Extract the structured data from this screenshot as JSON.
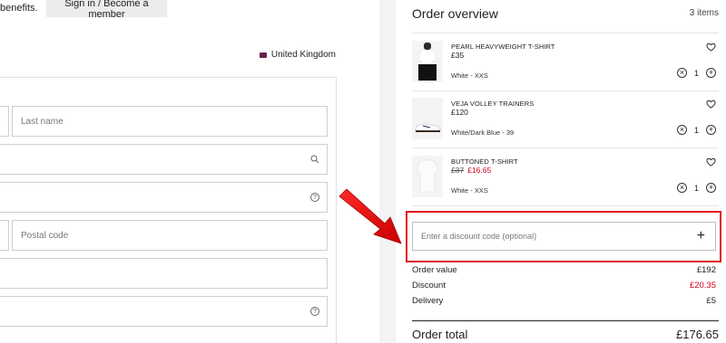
{
  "header": {
    "benefits_text": "benefits.",
    "signin_label": "Sign in / Become a member"
  },
  "country": {
    "label": "United Kingdom",
    "flag_color": "#6f1f4b"
  },
  "form": {
    "last_name_placeholder": "Last name",
    "postal_code_placeholder": "Postal code",
    "help_glyph": "?"
  },
  "overview": {
    "title": "Order overview",
    "count": "3 items",
    "items": [
      {
        "name": "PEARL HEAVYWEIGHT T-SHIRT",
        "price": "£35",
        "variant": "White - XXS",
        "qty": "1"
      },
      {
        "name": "VEJA VOLLEY TRAINERS",
        "price": "£120",
        "variant": "White/Dark Blue - 39",
        "qty": "1"
      },
      {
        "name": "BUTTONED T-SHIRT",
        "old_price": "£37",
        "new_price": "£16.65",
        "variant": "White - XXS",
        "qty": "1"
      }
    ],
    "discount_placeholder": "Enter a discount code (optional)",
    "summary": {
      "order_value_label": "Order value",
      "order_value": "£192",
      "discount_label": "Discount",
      "discount": "£20.35",
      "delivery_label": "Delivery",
      "delivery": "£5",
      "total_label": "Order total",
      "total": "£176.65"
    }
  },
  "colors": {
    "accent_red": "#d0021b",
    "highlight_red": "#e0161e"
  }
}
